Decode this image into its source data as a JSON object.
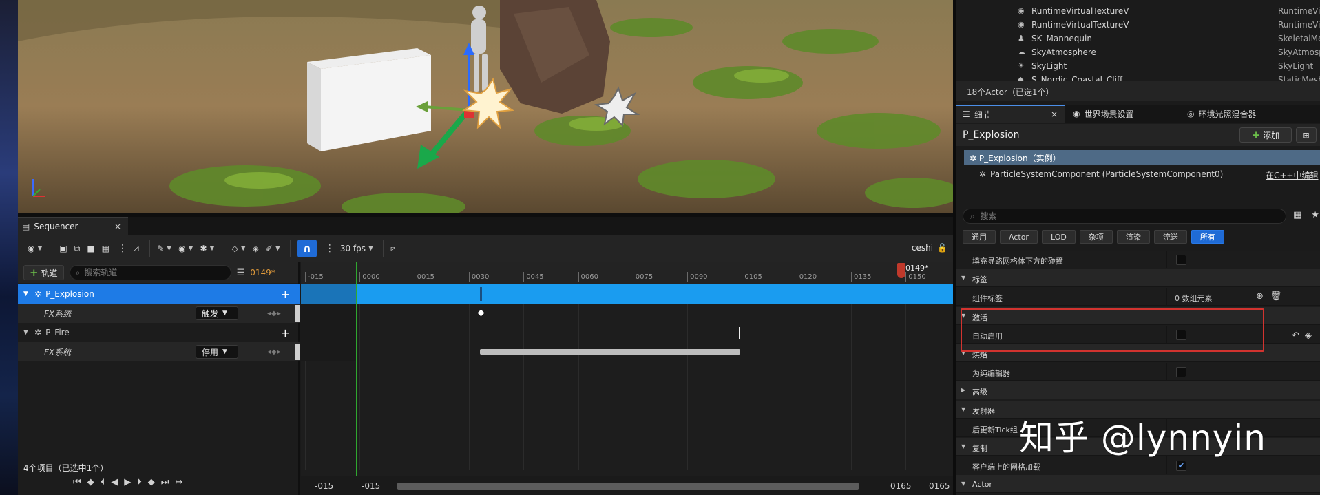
{
  "colors": {
    "accent": "#1f6bd6",
    "selection": "#1e7be6",
    "playhead": "#c0392b",
    "highlight_box": "#d2332f",
    "frame_number": "#e09a3b"
  },
  "sequencer": {
    "tab_title": "Sequencer",
    "tab_close": "×",
    "toolbar": {
      "fps": "30 fps",
      "user": "ceshi"
    },
    "add_track_label": "轨道",
    "search_placeholder": "搜索轨道",
    "current_frame": "0149*",
    "tracks": [
      {
        "name": "P_Explosion",
        "selected": true
      },
      {
        "name": "FX系统",
        "dropdown": "触发"
      },
      {
        "name": "P_Fire"
      },
      {
        "name": "FX系统",
        "dropdown": "停用"
      }
    ],
    "status": "4个项目（已选中1个）",
    "ruler_ticks": [
      "-015",
      "0000",
      "0015",
      "0030",
      "0045",
      "0060",
      "0075",
      "0090",
      "0105",
      "0120",
      "0135",
      "0150"
    ],
    "playhead_label": "0149*",
    "bottom": {
      "left1": "-015",
      "left2": "-015",
      "right1": "0165",
      "right2": "0165"
    }
  },
  "outliner": {
    "rows": [
      {
        "name": "RuntimeVirtualTextureV",
        "type": "RuntimeVir",
        "icon": "◉"
      },
      {
        "name": "RuntimeVirtualTextureV",
        "type": "RuntimeVir",
        "icon": "◉"
      },
      {
        "name": "SK_Mannequin",
        "type": "SkeletalMe",
        "icon": "♟"
      },
      {
        "name": "SkyAtmosphere",
        "type": "SkyAtmosp",
        "icon": "☁"
      },
      {
        "name": "SkyLight",
        "type": "SkyLight",
        "icon": "☀"
      },
      {
        "name": "S_Nordic_Coastal_Cliff_",
        "type": "StaticMesh",
        "icon": "◆"
      }
    ],
    "count": "18个Actor（已选1个）"
  },
  "details": {
    "tabs": [
      "细节",
      "世界场景设置",
      "环境光照混合器"
    ],
    "tab_close": "×",
    "title": "P_Explosion",
    "add_label": "添加",
    "component_root": "P_Explosion（实例）",
    "component_child": "ParticleSystemComponent (ParticleSystemComponent0)",
    "component_link": "在C++中编辑",
    "search_placeholder": "搜索",
    "categories": [
      "通用",
      "Actor",
      "LOD",
      "杂项",
      "渲染",
      "流送",
      "所有"
    ],
    "rows": [
      {
        "label": "填充寻路网格体下方的碰撞",
        "kind": "prop",
        "checked": false
      },
      {
        "label": "标签",
        "kind": "cat",
        "expanded": true
      },
      {
        "label": "组件标签",
        "kind": "prop",
        "value": "0 数组元素"
      },
      {
        "label": "激活",
        "kind": "cat",
        "expanded": true
      },
      {
        "label": "自动启用",
        "kind": "prop",
        "checked": false
      },
      {
        "label": "烘焙",
        "kind": "cat",
        "expanded": true
      },
      {
        "label": "为纯编辑器",
        "kind": "prop",
        "checked": false
      },
      {
        "label": "高级",
        "kind": "cat",
        "expanded": false
      },
      {
        "label": "发射器",
        "kind": "cat",
        "expanded": true
      },
      {
        "label": "后更新Tick组",
        "kind": "prop"
      },
      {
        "label": "复制",
        "kind": "cat",
        "expanded": true
      },
      {
        "label": "客户端上的网格加载",
        "kind": "prop",
        "checked": true
      },
      {
        "label": "Actor",
        "kind": "cat",
        "expanded": true
      }
    ]
  },
  "watermark": "知乎 @lynnyin"
}
